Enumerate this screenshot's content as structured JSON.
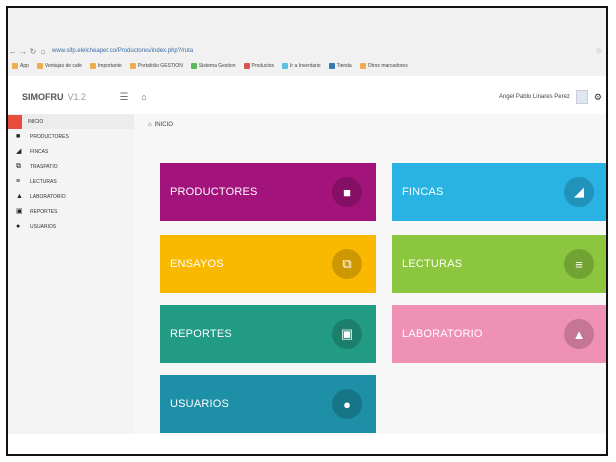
{
  "browser": {
    "address": "www.sifp.elelcheaper.co/Productores/index.php?/ruta",
    "bookmarks": [
      "App",
      "Ventajas de cafe",
      "Importante",
      "Portafolio GESTION",
      "Sistema Gestion",
      "Productos",
      "Ir a Inventario",
      "Tienda",
      "Otros marcadores"
    ]
  },
  "header": {
    "brand": "SIMOFRU",
    "version": "V1.2",
    "user": "Angel Pablo Linares Perez"
  },
  "sidebar": {
    "items": [
      {
        "label": "INICIO"
      },
      {
        "label": "PRODUCTORES"
      },
      {
        "label": "FINCAS"
      },
      {
        "label": "TRASPATIO"
      },
      {
        "label": "LECTURAS"
      },
      {
        "label": "LABORATORIO"
      },
      {
        "label": "REPORTES"
      },
      {
        "label": "USUARIOS"
      }
    ]
  },
  "breadcrumb": "INICIO",
  "tiles": [
    {
      "label": "PRODUCTORES",
      "color": "#a3137c",
      "icon": "briefcase-icon"
    },
    {
      "label": "FINCAS",
      "color": "#29b3e3",
      "icon": "tag-icon"
    },
    {
      "label": "ENSAYOS",
      "color": "#f9b900",
      "icon": "copy-icon"
    },
    {
      "label": "LECTURAS",
      "color": "#8cc63e",
      "icon": "list-icon"
    },
    {
      "label": "REPORTES",
      "color": "#229b84",
      "icon": "image-icon"
    },
    {
      "label": "LABORATORIO",
      "color": "#ef91b5",
      "icon": "flask-icon"
    },
    {
      "label": "USUARIOS",
      "color": "#1d8fa6",
      "icon": "users-icon"
    }
  ]
}
